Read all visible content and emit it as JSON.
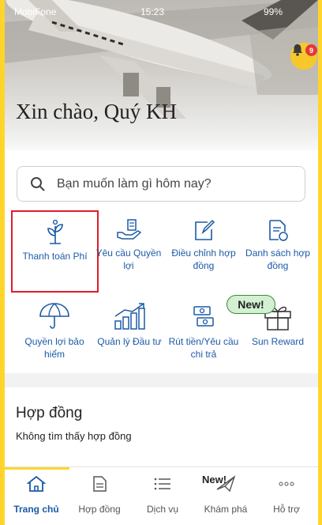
{
  "status_bar": {
    "carrier": "MobiFone",
    "time": "15:23",
    "battery": "99%"
  },
  "header": {
    "greeting": "Xin chào, Quý KH",
    "notification_count": "9"
  },
  "search": {
    "placeholder": "Bạn muốn làm gì hôm nay?"
  },
  "services": [
    {
      "label": "Thanh toán Phí",
      "icon": "plant-icon"
    },
    {
      "label": "Yêu cầu Quyền lợi",
      "icon": "hand-document-icon"
    },
    {
      "label": "Điều chỉnh hợp đồng",
      "icon": "edit-document-icon"
    },
    {
      "label": "Danh sách hợp đồng",
      "icon": "document-list-icon"
    },
    {
      "label": "Quyền lợi bảo hiểm",
      "icon": "umbrella-icon"
    },
    {
      "label": "Quản lý Đầu tư",
      "icon": "growth-chart-icon"
    },
    {
      "label": "Rút tiền/Yêu cầu chi trả",
      "icon": "cash-withdraw-icon"
    },
    {
      "label": "Sun Reward",
      "icon": "gift-icon"
    }
  ],
  "new_badge": "New!",
  "contracts": {
    "title": "Hợp đồng",
    "empty_message": "Không tìm thấy hợp đồng"
  },
  "bottom_nav": {
    "new_label": "New!",
    "items": [
      {
        "label": "Trang chủ",
        "icon": "home-icon"
      },
      {
        "label": "Hợp đồng",
        "icon": "document-icon"
      },
      {
        "label": "Dịch vụ",
        "icon": "list-icon"
      },
      {
        "label": "Khám phá",
        "icon": "paper-plane-icon"
      },
      {
        "label": "Hỗ trợ",
        "icon": "more-icon"
      }
    ]
  },
  "colors": {
    "brand_yellow": "#FFD52B",
    "link_blue": "#1c5aa6",
    "selection_red": "#e21c2a",
    "badge_red": "#e53935"
  }
}
